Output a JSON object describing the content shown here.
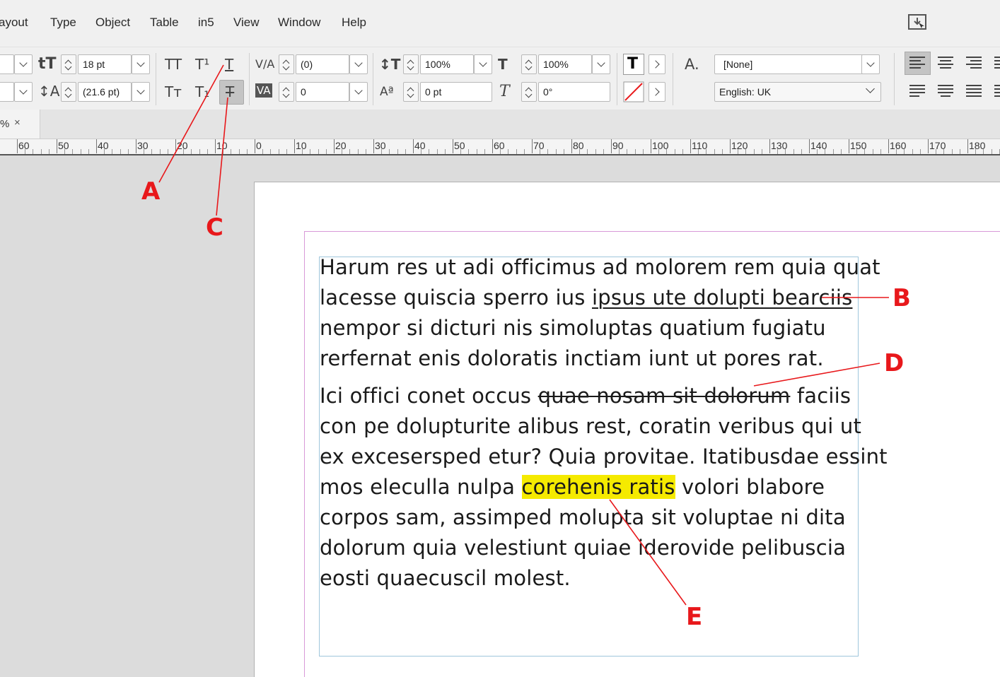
{
  "menu": {
    "items": [
      "ayout",
      "Type",
      "Object",
      "Table",
      "in5",
      "View",
      "Window",
      "Help"
    ]
  },
  "control_panel": {
    "font_size": "18 pt",
    "leading": "(21.6 pt)",
    "kerning": "(0)",
    "tracking": "0",
    "vertical_scale": "100%",
    "horizontal_scale": "100%",
    "baseline_shift": "0 pt",
    "skew": "0°",
    "char_style": "[None]",
    "language": "English: UK",
    "icons": {
      "all_caps": "TT",
      "superscript": "T¹",
      "underline": "T",
      "small_caps": "Tт",
      "subscript": "T₁",
      "strikethrough": "T",
      "fill": "T"
    }
  },
  "tab": {
    "label": "%",
    "close": "×"
  },
  "ruler": {
    "labels": [
      "60",
      "50",
      "40",
      "30",
      "20",
      "10",
      "0",
      "10",
      "20",
      "30",
      "40",
      "50",
      "60",
      "70",
      "80",
      "90",
      "100",
      "110",
      "120",
      "130",
      "140",
      "150",
      "160",
      "170",
      "180"
    ]
  },
  "document": {
    "para1": [
      [
        "Harum res ut adi officimus ad molorem rem quia quat"
      ],
      [
        "lacesse quiscia sperro ius ",
        "ipsus ute dolupti bearciis"
      ],
      [
        "nempor si dicturi nis simoluptas quatium fugiatu"
      ],
      [
        "rerfernat enis doloratis inctiam iunt ut pores rat."
      ]
    ],
    "para2": {
      "l1_a": "Ici offici conet occus ",
      "l1_strike": "quae nosam sit dolorum",
      "l1_b": " faciis",
      "l2": "con pe dolupturite alibus rest, coratin veribus qui ut",
      "l3": "ex excesersped etur? Quia provitae. Itatibusdae essint",
      "l4_a": "mos eleculla nulpa ",
      "l4_hl": "corehenis ratis",
      "l4_b": " volori blabore",
      "l5": "corpos sam, assimped molupta sit voluptae ni dita",
      "l6": "dolorum quia velestiunt quiae iderovide pelibuscia",
      "l7": "eosti quaecuscil molest."
    }
  },
  "callouts": [
    "A",
    "B",
    "C",
    "D",
    "E"
  ],
  "colors": {
    "callout": "#e8181b",
    "highlight": "#f5ea00",
    "margin_guide": "#d89ad8",
    "frame_edge": "#9fc6dc"
  }
}
